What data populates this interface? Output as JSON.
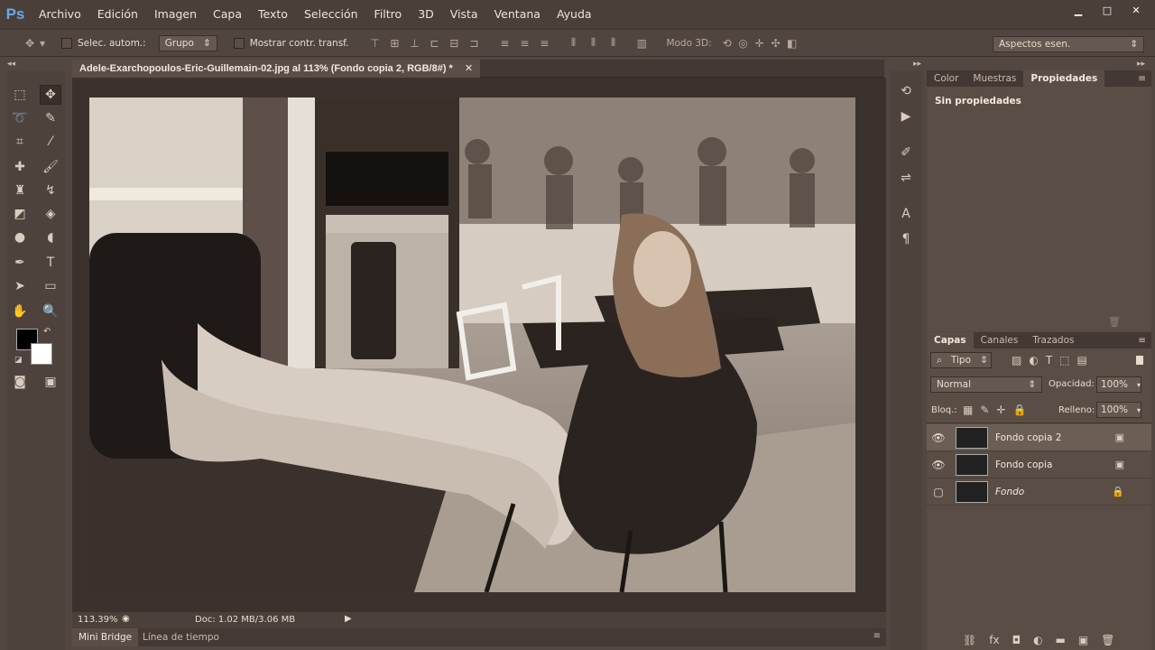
{
  "app": {
    "logo": "Ps"
  },
  "menu": [
    "Archivo",
    "Edición",
    "Imagen",
    "Capa",
    "Texto",
    "Selección",
    "Filtro",
    "3D",
    "Vista",
    "Ventana",
    "Ayuda"
  ],
  "window_controls": {
    "minimize": "▁",
    "maximize": "□",
    "close": "✕"
  },
  "options": {
    "auto_select_label": "Selec. autom.:",
    "auto_select_value": "Grupo",
    "show_transform_label": "Mostrar contr. transf.",
    "mode3d_label": "Modo 3D:",
    "workspace": "Aspectos esen."
  },
  "document": {
    "tab_title": "Adele-Exarchopoulos-Eric-Guillemain-02.jpg al 113% (Fondo copia 2, RGB/8#) *",
    "zoom": "113.39%",
    "doc_size": "Doc: 1.02 MB/3.06 MB"
  },
  "bottom_tabs": [
    "Mini Bridge",
    "Línea de tiempo"
  ],
  "properties": {
    "tabs": [
      "Color",
      "Muestras",
      "Propiedades"
    ],
    "active_tab": "Propiedades",
    "message": "Sin propiedades"
  },
  "layers": {
    "tabs": [
      "Capas",
      "Canales",
      "Trazados"
    ],
    "filter_kind": "Tipo",
    "blend_mode": "Normal",
    "opacity_label": "Opacidad:",
    "opacity": "100%",
    "lock_label": "Bloq.:",
    "fill_label": "Relleno:",
    "fill": "100%",
    "items": [
      {
        "name": "Fondo copia 2",
        "visible": true,
        "active": true
      },
      {
        "name": "Fondo copia",
        "visible": true,
        "active": false
      },
      {
        "name": "Fondo",
        "visible": false,
        "active": false
      }
    ]
  }
}
